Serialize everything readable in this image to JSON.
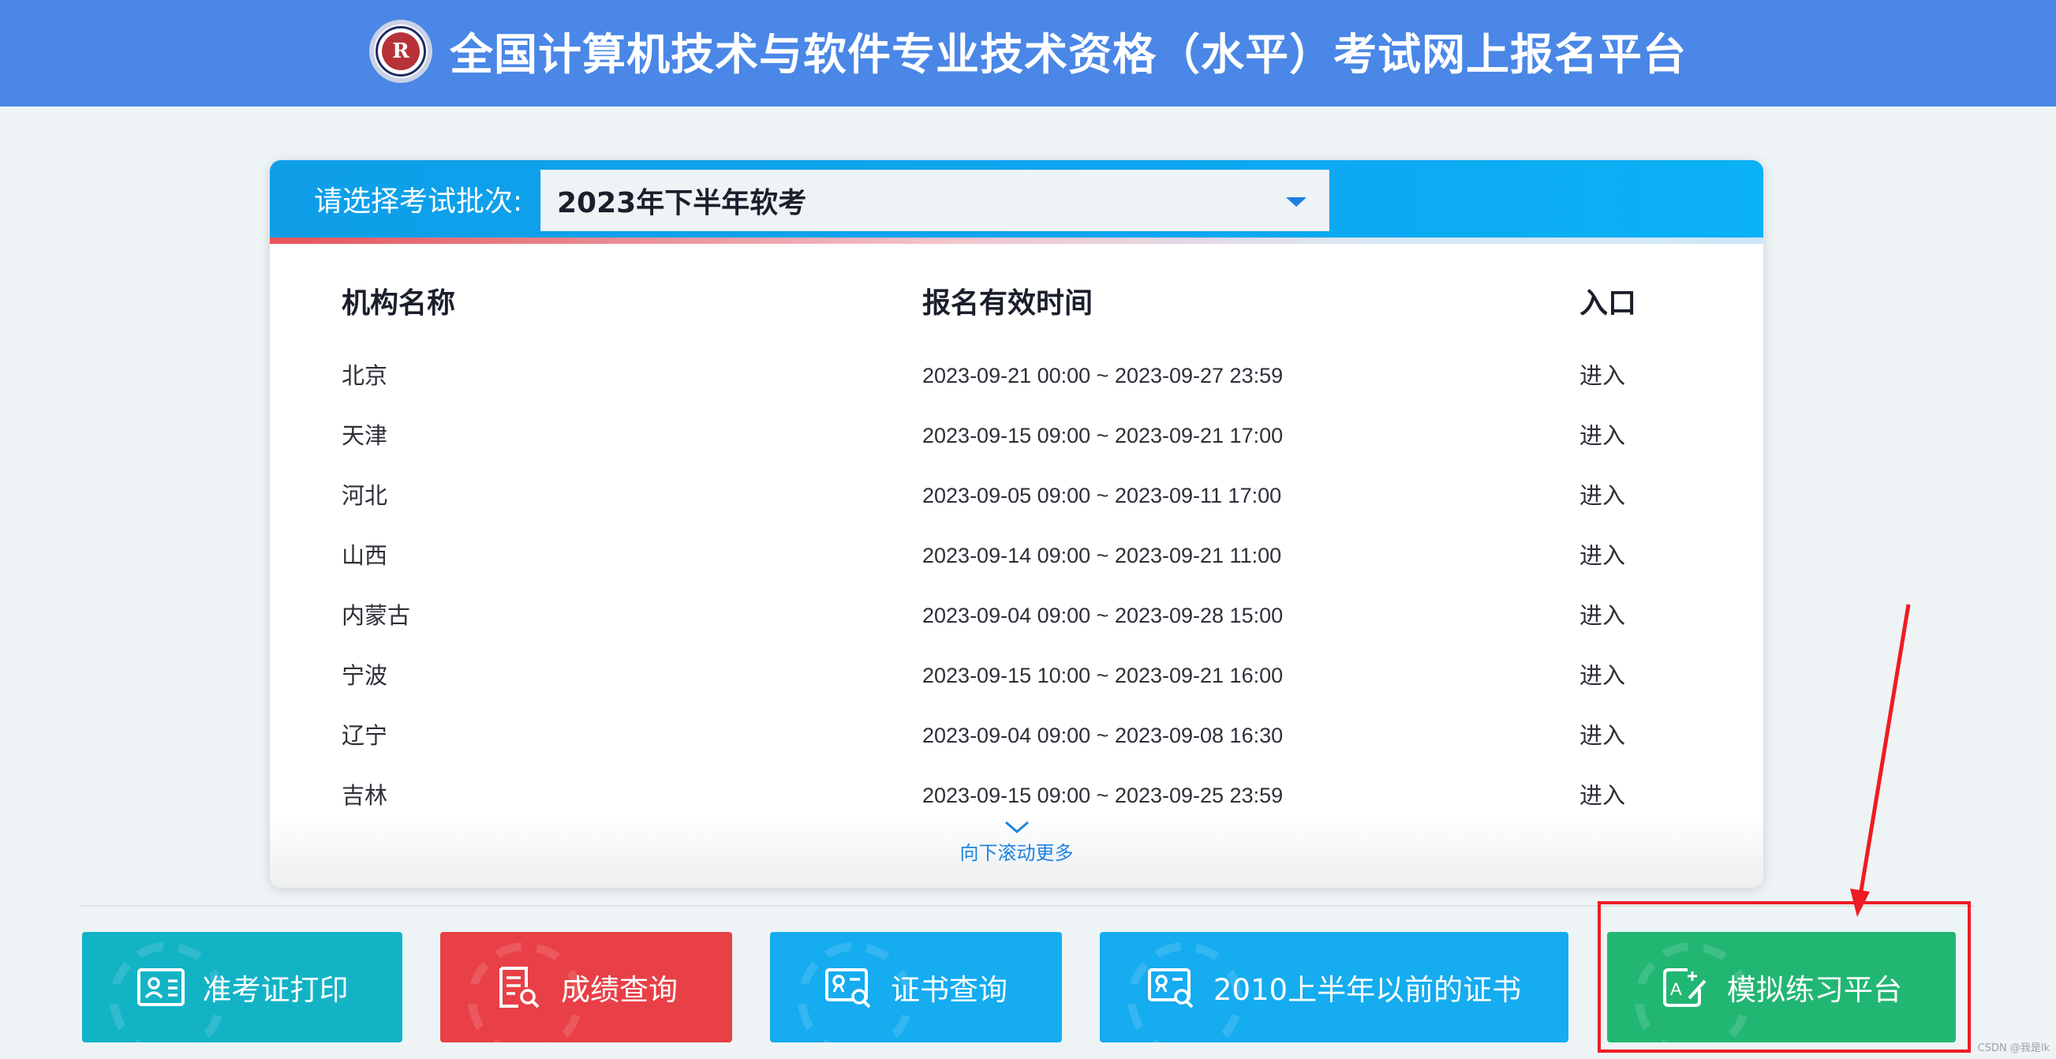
{
  "header": {
    "title": "全国计算机技术与软件专业技术资格（水平）考试网上报名平台",
    "logo_text": "R"
  },
  "batch": {
    "label": "请选择考试批次:",
    "selected": "2023年下半年软考"
  },
  "table": {
    "headers": [
      "机构名称",
      "报名有效时间",
      "入口"
    ],
    "rows": [
      {
        "name": "北京",
        "time": "2023-09-21 00:00 ~ 2023-09-27 23:59",
        "entry": "进入"
      },
      {
        "name": "天津",
        "time": "2023-09-15 09:00 ~ 2023-09-21 17:00",
        "entry": "进入"
      },
      {
        "name": "河北",
        "time": "2023-09-05 09:00 ~ 2023-09-11 17:00",
        "entry": "进入"
      },
      {
        "name": "山西",
        "time": "2023-09-14 09:00 ~ 2023-09-21 11:00",
        "entry": "进入"
      },
      {
        "name": "内蒙古",
        "time": "2023-09-04 09:00 ~ 2023-09-28 15:00",
        "entry": "进入"
      },
      {
        "name": "宁波",
        "time": "2023-09-15 10:00 ~ 2023-09-21 16:00",
        "entry": "进入"
      },
      {
        "name": "辽宁",
        "time": "2023-09-04 09:00 ~ 2023-09-08 16:30",
        "entry": "进入"
      },
      {
        "name": "吉林",
        "time": "2023-09-15 09:00 ~ 2023-09-25 23:59",
        "entry": "进入"
      }
    ],
    "scroll_more": "向下滚动更多"
  },
  "bottom_buttons": [
    {
      "label": "准考证打印",
      "icon": "id-card-icon",
      "color": "#13b3c6"
    },
    {
      "label": "成绩查询",
      "icon": "document-search-icon",
      "color": "#e84046"
    },
    {
      "label": "证书查询",
      "icon": "certificate-search-icon",
      "color": "#15acf0"
    },
    {
      "label": "2010上半年以前的证书",
      "icon": "certificate-search-icon",
      "color": "#15acf0"
    },
    {
      "label": "模拟练习平台",
      "icon": "edit-practice-icon",
      "color": "#22b673"
    }
  ],
  "annotation": {
    "highlight_color": "#ee1c24"
  },
  "watermark": "CSDN @我是lk"
}
